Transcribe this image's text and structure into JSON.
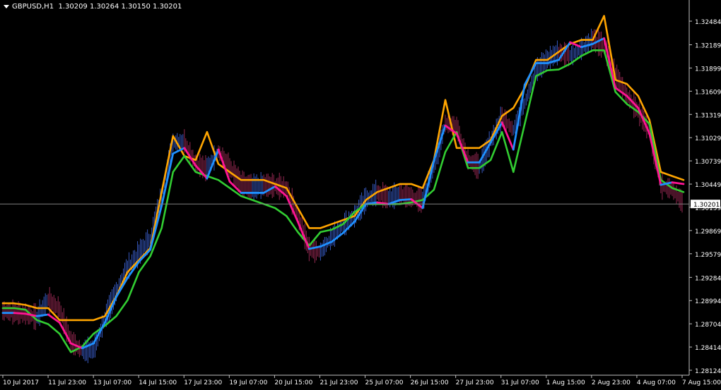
{
  "header": {
    "symbol": "GBPUSD,H1",
    "ohlc": "1.30209 1.30264 1.30150 1.30201"
  },
  "colors": {
    "background": "#000000",
    "axis": "#c0c0c0",
    "text": "#ffffff",
    "bars_up": "#4169e1",
    "bars_down": "#b03060",
    "trend_up": "#1e90ff",
    "trend_down": "#ff1493",
    "upper_band": "#ffa500",
    "lower_band": "#32cd32",
    "price_line": "#808080"
  },
  "chart_data": {
    "type": "line",
    "title": "GBPUSD,H1",
    "price_label": "1.30201",
    "current_price": 1.30201,
    "ylim": [
      1.28124,
      1.32484
    ],
    "y_ticks": [
      "1.32484",
      "1.32189",
      "1.31899",
      "1.31609",
      "1.31319",
      "1.31029",
      "1.30739",
      "1.30449",
      "1.30159",
      "1.29869",
      "1.29579",
      "1.29284",
      "1.28994",
      "1.28704",
      "1.28414",
      "1.28124"
    ],
    "x_ticks": [
      "10 Jul 2017",
      "11 Jul 23:00",
      "13 Jul 07:00",
      "14 Jul 15:00",
      "17 Jul 23:00",
      "19 Jul 07:00",
      "20 Jul 15:00",
      "21 Jul 23:00",
      "25 Jul 07:00",
      "26 Jul 15:00",
      "27 Jul 23:00",
      "31 Jul 07:00",
      "1 Aug 15:00",
      "2 Aug 23:00",
      "4 Aug 07:00",
      "7 Aug 15:00"
    ],
    "x": [
      0,
      4,
      8,
      12,
      16,
      20,
      24,
      28,
      32,
      36,
      40,
      44,
      48,
      52,
      56,
      60,
      64,
      68,
      72,
      76,
      80,
      84,
      88,
      92,
      96,
      100,
      104,
      108,
      112,
      116,
      120,
      124,
      128,
      132,
      136,
      140,
      144,
      148,
      152,
      156,
      160,
      164,
      168,
      172,
      176,
      180,
      184,
      188,
      192,
      196,
      200,
      204,
      208,
      212,
      216,
      220,
      224,
      228,
      232,
      236,
      240
    ],
    "series": [
      {
        "key": "close",
        "values": [
          1.2886,
          1.2884,
          1.2882,
          1.2878,
          1.29,
          1.2888,
          1.2848,
          1.2836,
          1.2838,
          1.2876,
          1.291,
          1.294,
          1.2958,
          1.2976,
          1.303,
          1.3096,
          1.3098,
          1.307,
          1.3063,
          1.3085,
          1.3065,
          1.3045,
          1.304,
          1.3043,
          1.3042,
          1.304,
          1.3005,
          1.2963,
          1.296,
          1.2978,
          1.2993,
          1.3004,
          1.3025,
          1.3034,
          1.3027,
          1.3032,
          1.3028,
          1.3024,
          1.3065,
          1.312,
          1.3116,
          1.3075,
          1.3065,
          1.3098,
          1.3128,
          1.3112,
          1.3145,
          1.3186,
          1.32,
          1.3209,
          1.3205,
          1.3213,
          1.3225,
          1.3216,
          1.3182,
          1.3155,
          1.3136,
          1.311,
          1.3042,
          1.3038,
          1.302
        ]
      },
      {
        "key": "fast_trend",
        "values": [
          1.2884,
          1.2884,
          1.2883,
          1.288,
          1.2882,
          1.2872,
          1.2846,
          1.284,
          1.2846,
          1.2872,
          1.2904,
          1.2928,
          1.2948,
          1.2963,
          1.3018,
          1.3083,
          1.309,
          1.3068,
          1.3052,
          1.3088,
          1.3048,
          1.3034,
          1.3034,
          1.3034,
          1.3042,
          1.303,
          1.2998,
          1.2964,
          1.2967,
          1.2973,
          1.2984,
          1.2998,
          1.302,
          1.3022,
          1.302,
          1.3025,
          1.3026,
          1.3015,
          1.3074,
          1.3118,
          1.3108,
          1.3072,
          1.3072,
          1.3097,
          1.3122,
          1.3088,
          1.3169,
          1.3196,
          1.3196,
          1.32,
          1.3222,
          1.3216,
          1.322,
          1.3227,
          1.3165,
          1.3155,
          1.314,
          1.3108,
          1.3044,
          1.3047,
          1.3045
        ]
      },
      {
        "key": "upper_band",
        "values": [
          1.2896,
          1.2896,
          1.2894,
          1.289,
          1.289,
          1.2875,
          1.2875,
          1.2875,
          1.2875,
          1.288,
          1.2905,
          1.2935,
          1.295,
          1.2965,
          1.3035,
          1.3105,
          1.308,
          1.3075,
          1.311,
          1.307,
          1.306,
          1.305,
          1.305,
          1.305,
          1.3045,
          1.304,
          1.3015,
          1.299,
          1.299,
          1.2995,
          1.3,
          1.3005,
          1.3025,
          1.3035,
          1.304,
          1.3045,
          1.3045,
          1.304,
          1.3075,
          1.315,
          1.309,
          1.309,
          1.309,
          1.31,
          1.313,
          1.314,
          1.3165,
          1.32,
          1.32,
          1.321,
          1.322,
          1.3225,
          1.3225,
          1.3255,
          1.3175,
          1.317,
          1.3155,
          1.3125,
          1.306,
          1.3055,
          1.305
        ]
      },
      {
        "key": "lower_band",
        "values": [
          1.289,
          1.289,
          1.2888,
          1.2875,
          1.287,
          1.2858,
          1.2835,
          1.2842,
          1.2858,
          1.2868,
          1.288,
          1.29,
          1.2935,
          1.2955,
          1.299,
          1.306,
          1.308,
          1.306,
          1.3055,
          1.305,
          1.304,
          1.303,
          1.3025,
          1.302,
          1.3015,
          1.3005,
          1.2985,
          1.2968,
          1.2985,
          1.2988,
          1.2995,
          1.301,
          1.302,
          1.302,
          1.302,
          1.302,
          1.3022,
          1.3025,
          1.3038,
          1.3085,
          1.311,
          1.3065,
          1.3065,
          1.3075,
          1.311,
          1.306,
          1.312,
          1.318,
          1.3187,
          1.3188,
          1.3195,
          1.3205,
          1.3212,
          1.3212,
          1.316,
          1.3145,
          1.3135,
          1.312,
          1.305,
          1.304,
          1.3035
        ]
      }
    ]
  }
}
